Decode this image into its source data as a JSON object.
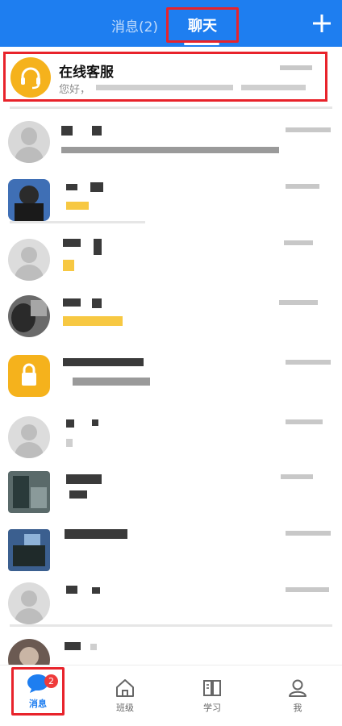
{
  "header": {
    "tab_messages": "消息(2)",
    "tab_chat": "聊天",
    "add_icon": "plus-icon",
    "background_color": "#1e7ef0",
    "highlight_color": "#e8232b"
  },
  "service_chat": {
    "name": "在线客服",
    "preview": "您好，",
    "icon": "headset-icon",
    "avatar_color": "#f5b21c"
  },
  "bottom_nav": {
    "items": [
      {
        "label": "消息",
        "icon": "chat-bubble-icon",
        "active": true,
        "badge": "2"
      },
      {
        "label": "班级",
        "icon": "house-icon",
        "active": false
      },
      {
        "label": "学习",
        "icon": "book-icon",
        "active": false
      },
      {
        "label": "我",
        "icon": "user-icon",
        "active": false
      }
    ]
  }
}
